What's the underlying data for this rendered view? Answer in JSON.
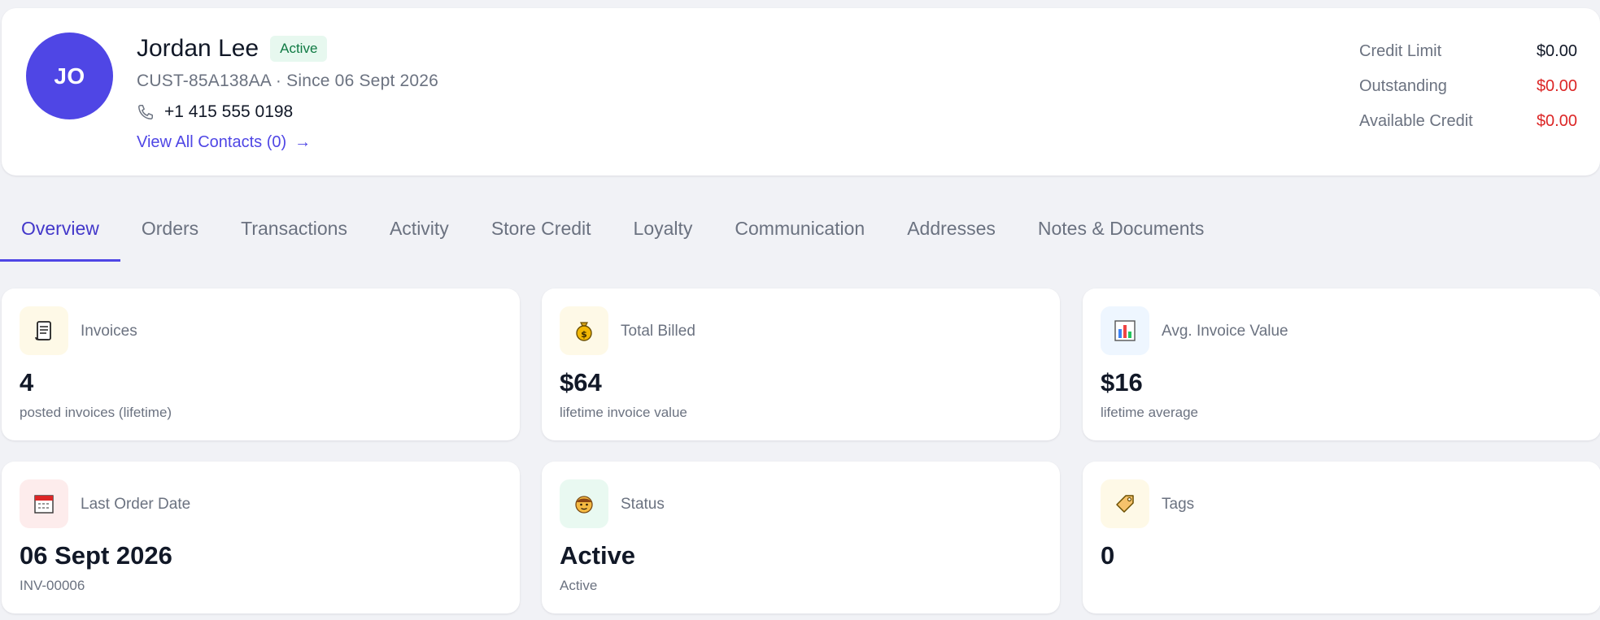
{
  "customer": {
    "initials": "JO",
    "name": "Jordan Lee",
    "status_badge": "Active",
    "meta": "CUST-85A138AA · Since 06 Sept 2026",
    "phone": "+1 415 555 0198",
    "contacts_link": "View All Contacts (0)",
    "avatar_color": "#4f46e5"
  },
  "credit": {
    "rows": [
      {
        "label": "Credit Limit",
        "value": "$0.00"
      },
      {
        "label": "Outstanding",
        "value": "$0.00"
      },
      {
        "label": "Available Credit",
        "value": "$0.00"
      }
    ]
  },
  "tabs": [
    {
      "label": "Overview",
      "active": true
    },
    {
      "label": "Orders"
    },
    {
      "label": "Transactions"
    },
    {
      "label": "Activity"
    },
    {
      "label": "Store Credit"
    },
    {
      "label": "Loyalty"
    },
    {
      "label": "Communication"
    },
    {
      "label": "Addresses"
    },
    {
      "label": "Notes & Documents"
    }
  ],
  "stats": [
    {
      "label": "Invoices",
      "value": "4",
      "sub": "posted invoices (lifetime)",
      "icon": "scroll-icon",
      "icon_bg": "#fef9e7"
    },
    {
      "label": "Total Billed",
      "value": "$64",
      "sub": "lifetime invoice value",
      "icon": "money-bag-icon",
      "icon_bg": "#fef9e7"
    },
    {
      "label": "Avg. Invoice Value",
      "value": "$16",
      "sub": "lifetime average",
      "icon": "bar-chart-icon",
      "icon_bg": "#eef6ff"
    },
    {
      "label": "Last Order Date",
      "value": "06 Sept 2026",
      "sub": "INV-00006",
      "icon": "calendar-icon",
      "icon_bg": "#fdecec"
    },
    {
      "label": "Status",
      "value": "Active",
      "sub": "Active",
      "icon": "person-face-icon",
      "icon_bg": "#e9f9f1"
    },
    {
      "label": "Tags",
      "value": "0",
      "sub": "",
      "icon": "tag-icon",
      "icon_bg": "#fef9e7"
    }
  ],
  "colors": {
    "accent": "#4f46e5",
    "danger": "#dc2626",
    "success": "#0f7a43"
  }
}
